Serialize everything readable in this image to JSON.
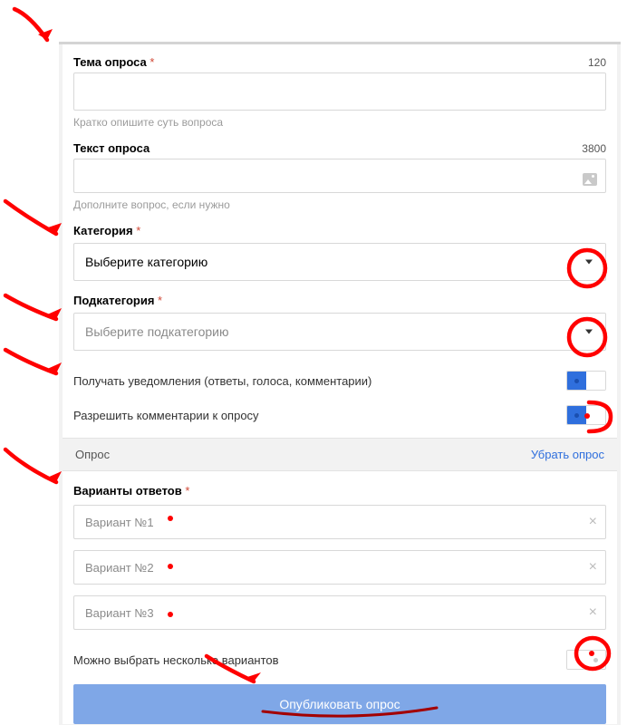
{
  "theme": {
    "label": "Тема опроса",
    "count": "120",
    "hint": "Кратко опишите суть вопроса"
  },
  "text": {
    "label": "Текст опроса",
    "count": "3800",
    "hint": "Дополните вопрос, если нужно"
  },
  "category": {
    "label": "Категория",
    "placeholder": "Выберите категорию"
  },
  "subcategory": {
    "label": "Подкатегория",
    "placeholder": "Выберите подкатегорию"
  },
  "notify": {
    "label": "Получать уведомления (ответы, голоса, комментарии)"
  },
  "comments": {
    "label": "Разрешить комментарии к опросу"
  },
  "section": {
    "title": "Опрос",
    "remove": "Убрать опрос"
  },
  "answers": {
    "label": "Варианты ответов",
    "options": [
      "Вариант №1",
      "Вариант №2",
      "Вариант №3"
    ]
  },
  "multi": {
    "label": "Можно выбрать несколько вариантов"
  },
  "publish": {
    "label": "Опубликовать опрос"
  }
}
